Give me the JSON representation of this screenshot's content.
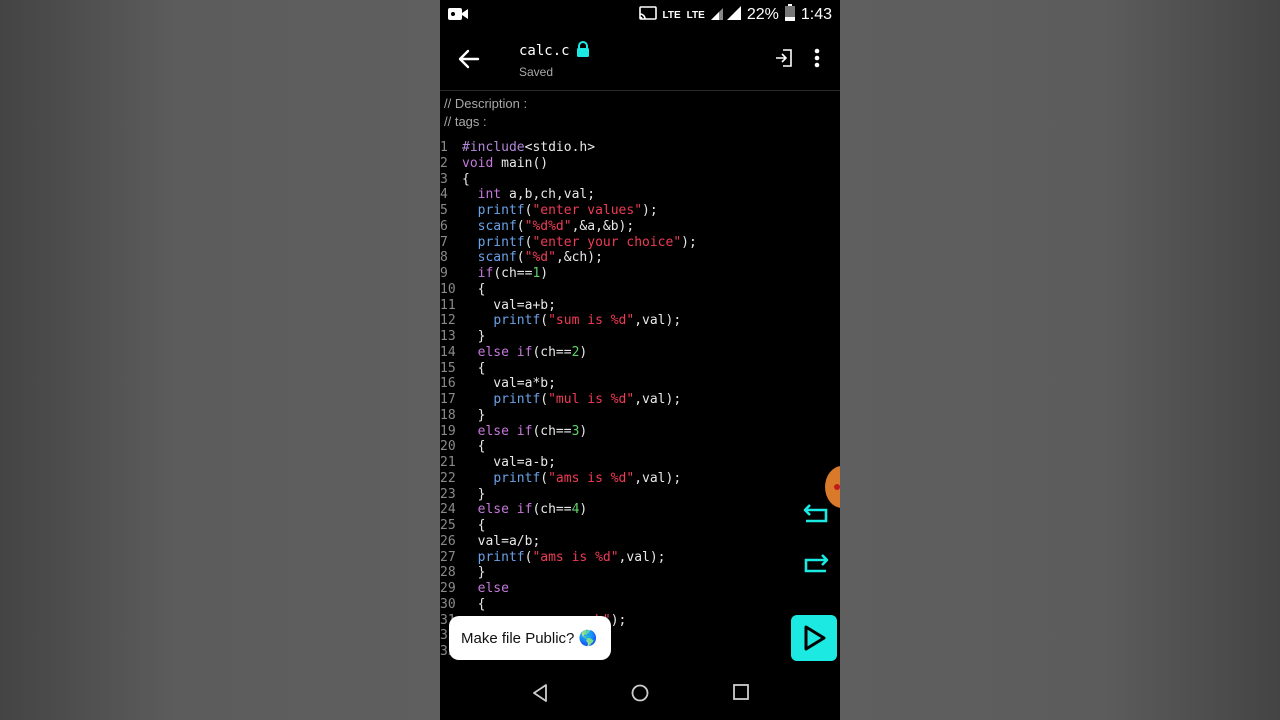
{
  "status_bar": {
    "lte1": "LTE",
    "lte2": "LTE",
    "battery": "22%",
    "time": "1:43",
    "icons": [
      "video-camera-icon",
      "cast-icon",
      "signal-icon",
      "battery-icon"
    ]
  },
  "app_bar": {
    "title": "calc.c",
    "subtitle": "Saved",
    "icons": [
      "back-arrow-icon",
      "lock-icon",
      "enter-icon",
      "more-vert-icon"
    ]
  },
  "comments": [
    "// Description :",
    "// tags :"
  ],
  "code": [
    {
      "n": "1",
      "parts": [
        [
          "pp",
          "#include"
        ],
        [
          "",
          "<stdio.h>"
        ]
      ]
    },
    {
      "n": "2",
      "parts": [
        [
          "kw",
          "void"
        ],
        [
          "",
          " main()"
        ]
      ]
    },
    {
      "n": "3",
      "parts": [
        [
          "",
          "{"
        ]
      ]
    },
    {
      "n": "4",
      "parts": [
        [
          "",
          "  "
        ],
        [
          "kw",
          "int"
        ],
        [
          "",
          " a,b,ch,val;"
        ]
      ]
    },
    {
      "n": "5",
      "parts": [
        [
          "",
          "  "
        ],
        [
          "fn",
          "printf"
        ],
        [
          "",
          "("
        ],
        [
          "str",
          "\"enter values\""
        ],
        [
          "",
          ");"
        ]
      ]
    },
    {
      "n": "6",
      "parts": [
        [
          "",
          "  "
        ],
        [
          "fn",
          "scanf"
        ],
        [
          "",
          "("
        ],
        [
          "str",
          "\"%d%d\""
        ],
        [
          "",
          ",&a,&b);"
        ]
      ]
    },
    {
      "n": "7",
      "parts": [
        [
          "",
          "  "
        ],
        [
          "fn",
          "printf"
        ],
        [
          "",
          "("
        ],
        [
          "str",
          "\"enter your choice\""
        ],
        [
          "",
          ");"
        ]
      ]
    },
    {
      "n": "8",
      "parts": [
        [
          "",
          "  "
        ],
        [
          "fn",
          "scanf"
        ],
        [
          "",
          "("
        ],
        [
          "str",
          "\"%d\""
        ],
        [
          "",
          ",&ch);"
        ]
      ]
    },
    {
      "n": "9",
      "parts": [
        [
          "",
          "  "
        ],
        [
          "kw",
          "if"
        ],
        [
          "",
          "(ch=="
        ],
        [
          "num",
          "1"
        ],
        [
          "",
          ")"
        ]
      ]
    },
    {
      "n": "10",
      "parts": [
        [
          "",
          "  {"
        ]
      ]
    },
    {
      "n": "11",
      "parts": [
        [
          "",
          "    val=a+b;"
        ]
      ]
    },
    {
      "n": "12",
      "parts": [
        [
          "",
          "    "
        ],
        [
          "fn",
          "printf"
        ],
        [
          "",
          "("
        ],
        [
          "str",
          "\"sum is %d\""
        ],
        [
          "",
          ",val);"
        ]
      ]
    },
    {
      "n": "13",
      "parts": [
        [
          "",
          "  }"
        ]
      ]
    },
    {
      "n": "14",
      "parts": [
        [
          "",
          "  "
        ],
        [
          "kw",
          "else if"
        ],
        [
          "",
          "(ch=="
        ],
        [
          "num",
          "2"
        ],
        [
          "",
          ")"
        ]
      ]
    },
    {
      "n": "15",
      "parts": [
        [
          "",
          "  {"
        ]
      ]
    },
    {
      "n": "16",
      "parts": [
        [
          "",
          "    val=a*b;"
        ]
      ]
    },
    {
      "n": "17",
      "parts": [
        [
          "",
          "    "
        ],
        [
          "fn",
          "printf"
        ],
        [
          "",
          "("
        ],
        [
          "str",
          "\"mul is %d\""
        ],
        [
          "",
          ",val);"
        ]
      ]
    },
    {
      "n": "18",
      "parts": [
        [
          "",
          "  }"
        ]
      ]
    },
    {
      "n": "19",
      "parts": [
        [
          "",
          "  "
        ],
        [
          "kw",
          "else if"
        ],
        [
          "",
          "(ch=="
        ],
        [
          "num",
          "3"
        ],
        [
          "",
          ")"
        ]
      ]
    },
    {
      "n": "20",
      "parts": [
        [
          "",
          "  {"
        ]
      ]
    },
    {
      "n": "21",
      "parts": [
        [
          "",
          "    val=a-b;"
        ]
      ]
    },
    {
      "n": "22",
      "parts": [
        [
          "",
          "    "
        ],
        [
          "fn",
          "printf"
        ],
        [
          "",
          "("
        ],
        [
          "str",
          "\"ams is %d\""
        ],
        [
          "",
          ",val);"
        ]
      ]
    },
    {
      "n": "23",
      "parts": [
        [
          "",
          "  }"
        ]
      ]
    },
    {
      "n": "24",
      "parts": [
        [
          "",
          "  "
        ],
        [
          "kw",
          "else if"
        ],
        [
          "",
          "(ch=="
        ],
        [
          "num",
          "4"
        ],
        [
          "",
          ")"
        ]
      ]
    },
    {
      "n": "25",
      "parts": [
        [
          "",
          "  {"
        ]
      ]
    },
    {
      "n": "26",
      "parts": [
        [
          "",
          "  val=a/b;"
        ]
      ]
    },
    {
      "n": "27",
      "parts": [
        [
          "",
          "  "
        ],
        [
          "fn",
          "printf"
        ],
        [
          "",
          "("
        ],
        [
          "str",
          "\"ams is %d\""
        ],
        [
          "",
          ",val);"
        ]
      ]
    },
    {
      "n": "28",
      "parts": [
        [
          "",
          "  }"
        ]
      ]
    },
    {
      "n": "29",
      "parts": [
        [
          "",
          "  "
        ],
        [
          "kw",
          "else"
        ]
      ]
    },
    {
      "n": "30",
      "parts": [
        [
          "",
          "  {"
        ]
      ]
    },
    {
      "n": "31",
      "parts": [
        [
          "",
          "                "
        ],
        [
          "str",
          "ch\""
        ],
        [
          "",
          ");"
        ]
      ]
    },
    {
      "n": "32",
      "parts": [
        [
          "",
          ""
        ]
      ]
    },
    {
      "n": "33",
      "parts": [
        [
          "",
          ""
        ]
      ]
    }
  ],
  "toast": {
    "label": "Make file Public? 🌎"
  },
  "colors": {
    "accent": "#1de9e3",
    "keyword": "#c678dd",
    "function": "#6aa2e8",
    "string": "#ef3b56",
    "number": "#5fd068"
  },
  "buttons": [
    "undo-icon",
    "redo-icon",
    "run-play-icon"
  ],
  "nav_bar": [
    "nav-back-icon",
    "nav-home-icon",
    "nav-recents-icon"
  ]
}
